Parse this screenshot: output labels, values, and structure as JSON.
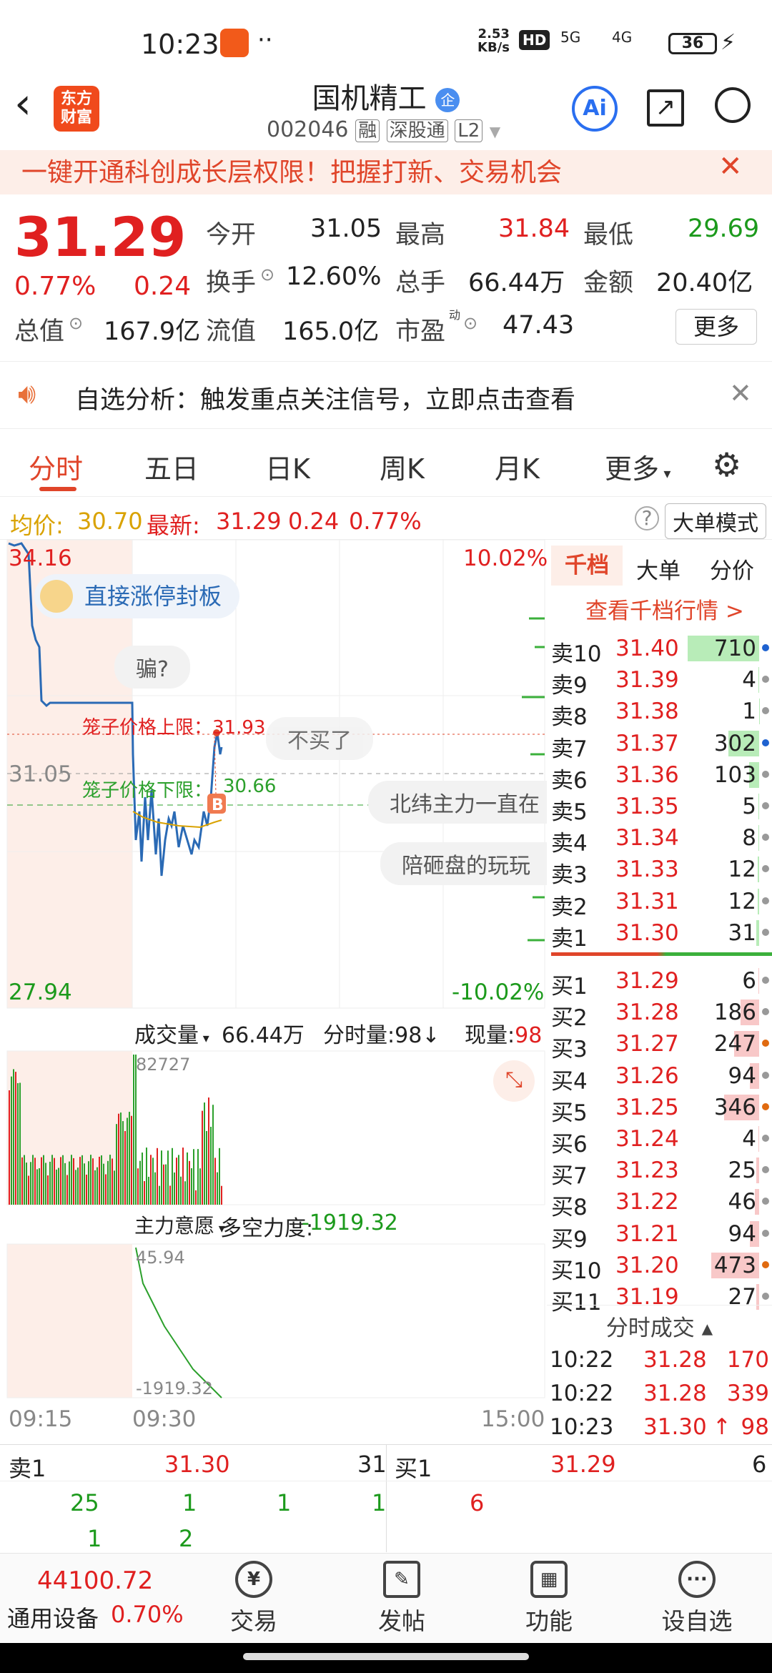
{
  "status": {
    "time": "10:23",
    "speed_top": "2.53",
    "speed_unit": "KB/s",
    "hd": "HD",
    "net1": "5G",
    "net2": "4G",
    "battery": "36"
  },
  "header": {
    "back_icon": "chevron-left-icon",
    "logo_line1": "东方",
    "logo_line2": "财富",
    "title": "国机精工",
    "badge": "企",
    "code": "002046",
    "tags": [
      "融",
      "深股通",
      "L2"
    ]
  },
  "banner": {
    "text": "一键开通科创成长层权限！把握打新、交易机会"
  },
  "quote": {
    "price": "31.29",
    "change_pct": "0.77%",
    "change": "0.24",
    "fields": [
      {
        "label": "今开",
        "value": "31.05",
        "color": "#222"
      },
      {
        "label": "最高",
        "value": "31.84",
        "color": "#e02020"
      },
      {
        "label": "最低",
        "value": "29.69",
        "color": "#1c9a1c"
      },
      {
        "label": "换手",
        "value": "12.60%",
        "color": "#222"
      },
      {
        "label": "总手",
        "value": "66.44万",
        "color": "#222"
      },
      {
        "label": "金额",
        "value": "20.40亿",
        "color": "#222"
      },
      {
        "label": "总值",
        "value": "167.9亿",
        "color": "#222"
      },
      {
        "label": "流值",
        "value": "165.0亿",
        "color": "#222"
      },
      {
        "label": "市盈",
        "value": "47.43",
        "color": "#222"
      }
    ],
    "pe_sup": "动",
    "more_button": "更多"
  },
  "alert": {
    "text": "自选分析：触发重点关注信号，立即点击查看"
  },
  "tabs": [
    "分时",
    "五日",
    "日K",
    "周K",
    "月K",
    "更多"
  ],
  "infoline": {
    "avg_label": "均价:",
    "avg": "30.70",
    "latest_label": "最新:",
    "latest": "31.29",
    "chg": "0.24",
    "pct": "0.77%",
    "mode_button": "大单模式"
  },
  "chart": {
    "y_top": "34.16",
    "y_mid": "31.05",
    "y_bottom": "27.94",
    "pct_top": "10.02%",
    "pct_bottom": "-10.02%",
    "cage_upper_label": "笼子价格上限：",
    "cage_upper": "31.93",
    "cage_lower_label": "笼子价格下限：",
    "cage_lower": "30.66",
    "promo": "直接涨停封板",
    "comments": [
      "骗?",
      "不买了",
      "北纬主力一直在",
      "陪砸盘的玩玩"
    ],
    "volume_label": "成交量",
    "volume": "66.44万",
    "min_vol_label": "分时量:",
    "min_vol": "98",
    "cur_vol_label": "现量:",
    "cur_vol": "98",
    "vol_max": "82727",
    "force_label": "主力意愿",
    "force_name": "多空力度:",
    "force_value": "-1919.32",
    "force_top": "45.94",
    "force_bottom": "-1919.32",
    "time_start": "09:15",
    "time_mid": "09:30",
    "time_end": "15:00"
  },
  "book": {
    "tabs": [
      "千档",
      "大单",
      "分价"
    ],
    "link": "查看千档行情 >",
    "sells": [
      {
        "label": "卖10",
        "price": "31.40",
        "vol": "710",
        "dot": "#1e62d0"
      },
      {
        "label": "卖9",
        "price": "31.39",
        "vol": "4",
        "dot": "#999"
      },
      {
        "label": "卖8",
        "price": "31.38",
        "vol": "1",
        "dot": "#999"
      },
      {
        "label": "卖7",
        "price": "31.37",
        "vol": "302",
        "dot": "#1e62d0"
      },
      {
        "label": "卖6",
        "price": "31.36",
        "vol": "103",
        "dot": "#999"
      },
      {
        "label": "卖5",
        "price": "31.35",
        "vol": "5",
        "dot": "#999"
      },
      {
        "label": "卖4",
        "price": "31.34",
        "vol": "8",
        "dot": "#999"
      },
      {
        "label": "卖3",
        "price": "31.33",
        "vol": "12",
        "dot": "#999"
      },
      {
        "label": "卖2",
        "price": "31.31",
        "vol": "12",
        "dot": "#999"
      },
      {
        "label": "卖1",
        "price": "31.30",
        "vol": "31",
        "dot": "#999"
      }
    ],
    "buys": [
      {
        "label": "买1",
        "price": "31.29",
        "vol": "6",
        "dot": "#999"
      },
      {
        "label": "买2",
        "price": "31.28",
        "vol": "186",
        "dot": "#999"
      },
      {
        "label": "买3",
        "price": "31.27",
        "vol": "247",
        "dot": "#e06a10"
      },
      {
        "label": "买4",
        "price": "31.26",
        "vol": "94",
        "dot": "#999"
      },
      {
        "label": "买5",
        "price": "31.25",
        "vol": "346",
        "dot": "#e06a10"
      },
      {
        "label": "买6",
        "price": "31.24",
        "vol": "4",
        "dot": "#999"
      },
      {
        "label": "买7",
        "price": "31.23",
        "vol": "25",
        "dot": "#999"
      },
      {
        "label": "买8",
        "price": "31.22",
        "vol": "46",
        "dot": "#999"
      },
      {
        "label": "买9",
        "price": "31.21",
        "vol": "94",
        "dot": "#999"
      },
      {
        "label": "买10",
        "price": "31.20",
        "vol": "473",
        "dot": "#e06a10"
      },
      {
        "label": "买11",
        "price": "31.19",
        "vol": "27",
        "dot": "#999"
      }
    ],
    "ticks_title": "分时成交",
    "ticks": [
      {
        "time": "10:22",
        "price": "31.28",
        "vol": "170",
        "arrow": ""
      },
      {
        "time": "10:22",
        "price": "31.28",
        "vol": "339",
        "arrow": ""
      },
      {
        "time": "10:23",
        "price": "31.30",
        "vol": "98",
        "arrow": "↑"
      }
    ]
  },
  "l2": {
    "sell_label": "卖1",
    "sell_price": "31.30",
    "sell_total": "31",
    "buy_label": "买1",
    "buy_price": "31.29",
    "buy_total": "6",
    "sell_queue_row1": [
      "25",
      "1",
      "1",
      "1"
    ],
    "sell_queue_row2": [
      "1",
      "2"
    ],
    "buy_queue": [
      "6"
    ]
  },
  "nav": {
    "index_value": "44100.72",
    "index_name": "通用设备",
    "index_pct": "0.70%",
    "items": [
      "交易",
      "发帖",
      "功能",
      "设自选"
    ]
  }
}
